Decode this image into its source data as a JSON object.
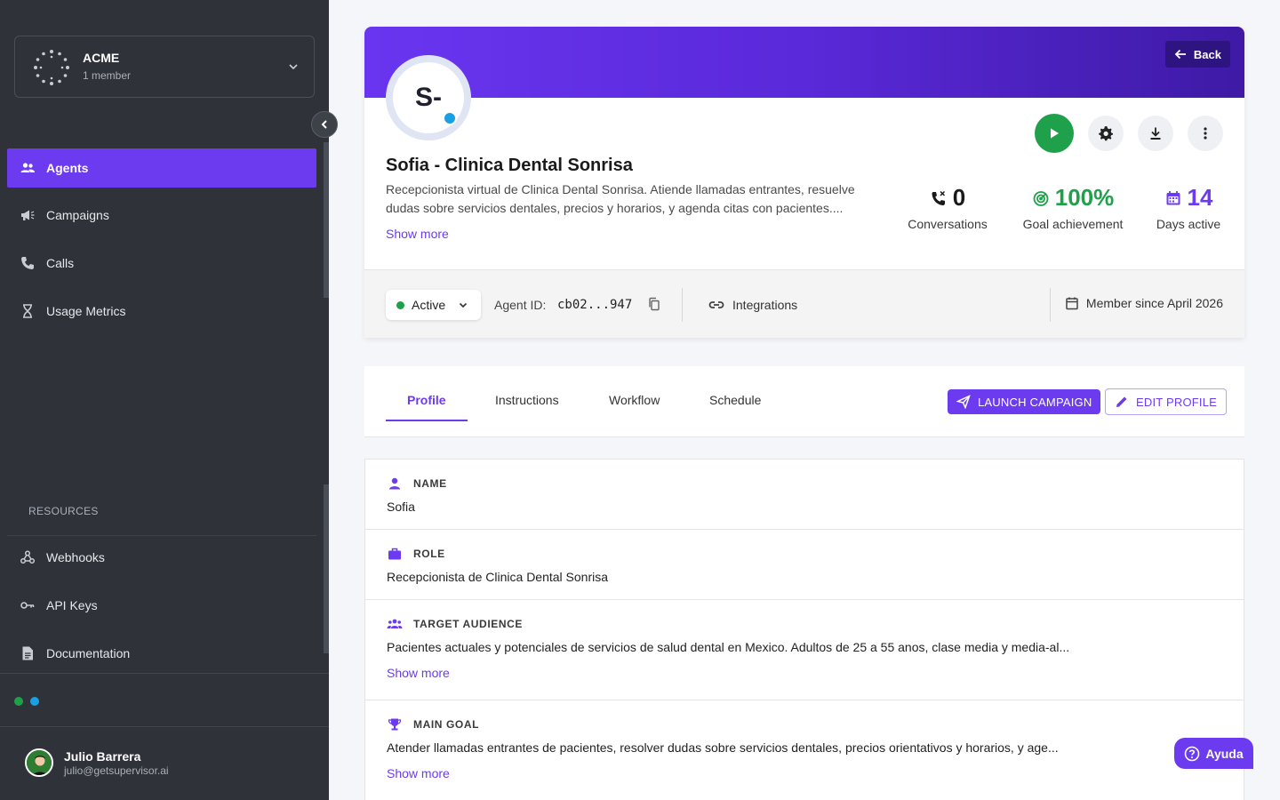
{
  "org": {
    "name": "ACME",
    "members": "1 member"
  },
  "nav": {
    "items": [
      {
        "label": "Agents",
        "icon": "people-icon",
        "active": true
      },
      {
        "label": "Campaigns",
        "icon": "megaphone-icon"
      },
      {
        "label": "Calls",
        "icon": "phone-icon"
      },
      {
        "label": "Usage Metrics",
        "icon": "hourglass-icon"
      }
    ],
    "resources_label": "RESOURCES",
    "resources": [
      {
        "label": "Webhooks",
        "icon": "webhook-icon"
      },
      {
        "label": "API Keys",
        "icon": "key-icon"
      },
      {
        "label": "Documentation",
        "icon": "document-icon"
      }
    ]
  },
  "user": {
    "name": "Julio Barrera",
    "email": "julio@getsupervisor.ai"
  },
  "agent": {
    "initials": "S-",
    "title": "Sofia - Clinica Dental Sonrisa",
    "description": "Recepcionista virtual de Clinica Dental Sonrisa. Atiende llamadas entrantes, resuelve dudas sobre servicios dentales, precios y horarios, y agenda citas con pacientes....",
    "show_more": "Show more",
    "back_label": "Back",
    "stats": [
      {
        "value": "0",
        "label": "Conversations",
        "color": "#1a1a1a"
      },
      {
        "value": "100%",
        "label": "Goal achievement",
        "color": "#1fa04a"
      },
      {
        "value": "14",
        "label": "Days active",
        "color": "#6c3bf0"
      }
    ],
    "status": "Active",
    "agent_id_label": "Agent ID:",
    "agent_id": "cb02...947",
    "integrations_label": "Integrations",
    "member_since": "Member since April 2026"
  },
  "tabs": [
    {
      "label": "Profile",
      "active": true
    },
    {
      "label": "Instructions"
    },
    {
      "label": "Workflow"
    },
    {
      "label": "Schedule"
    }
  ],
  "actions": {
    "launch": "LAUNCH CAMPAIGN",
    "edit": "EDIT PROFILE"
  },
  "profile": {
    "name_label": "NAME",
    "name_value": "Sofia",
    "role_label": "ROLE",
    "role_value": "Recepcionista de Clinica Dental Sonrisa",
    "audience_label": "TARGET AUDIENCE",
    "audience_value": "Pacientes actuales y potenciales de servicios de salud dental en Mexico. Adultos de 25 a 55 anos, clase media y media-al...",
    "goal_label": "MAIN GOAL",
    "goal_value": "Atender llamadas entrantes de pacientes, resolver dudas sobre servicios dentales, precios orientativos y horarios, y age...",
    "show_more": "Show more"
  },
  "help": {
    "label": "Ayuda"
  },
  "colors": {
    "accent": "#6c3bf0",
    "success": "#1fa04a",
    "sidebar": "#2f3238"
  }
}
